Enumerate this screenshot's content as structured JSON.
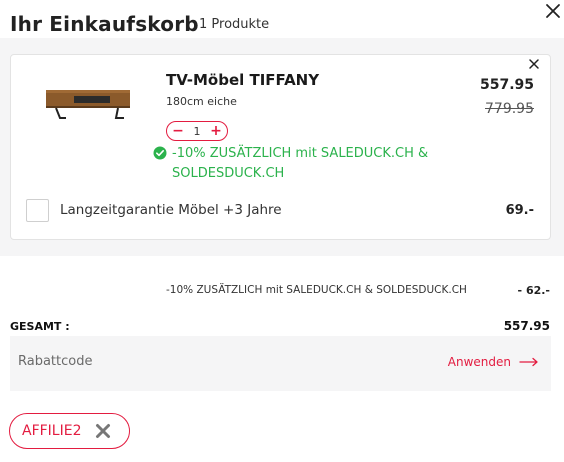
{
  "header": {
    "title": "Ihr Einkaufskorb",
    "count_label": "1 Produkte",
    "close_icon": "close-icon"
  },
  "cart_item": {
    "name": "TV-Möbel TIFFANY",
    "variant": "180cm eiche",
    "quantity": "1",
    "price_current": "557.95",
    "price_original": "779.95",
    "promo_text": "-10% ZUSÄTZLICH mit SALEDUCK.CH & SOLDESDUCK.CH",
    "remove_icon": "close-icon",
    "promo_icon": "check-circle-icon",
    "minus_symbol": "−",
    "plus_symbol": "+"
  },
  "warranty": {
    "label": "Langzeitgarantie Möbel +3 Jahre",
    "price": "69.-",
    "checked": false
  },
  "summary": {
    "discount_label": "-10% ZUSÄTZLICH mit SALEDUCK.CH & SOLDESDUCK.CH",
    "discount_value": "- 62.-",
    "total_label": "GESAMT :",
    "total_value": "557.95"
  },
  "coupon": {
    "placeholder": "Rabattcode",
    "value": "",
    "apply_label": "Anwenden",
    "apply_icon": "arrow-right-icon"
  },
  "applied_code": {
    "label": "AFFILIE2",
    "remove_icon": "close-icon"
  },
  "colors": {
    "accent": "#e31c40",
    "success": "#2bb24c",
    "panel_bg": "#f5f5f6"
  }
}
